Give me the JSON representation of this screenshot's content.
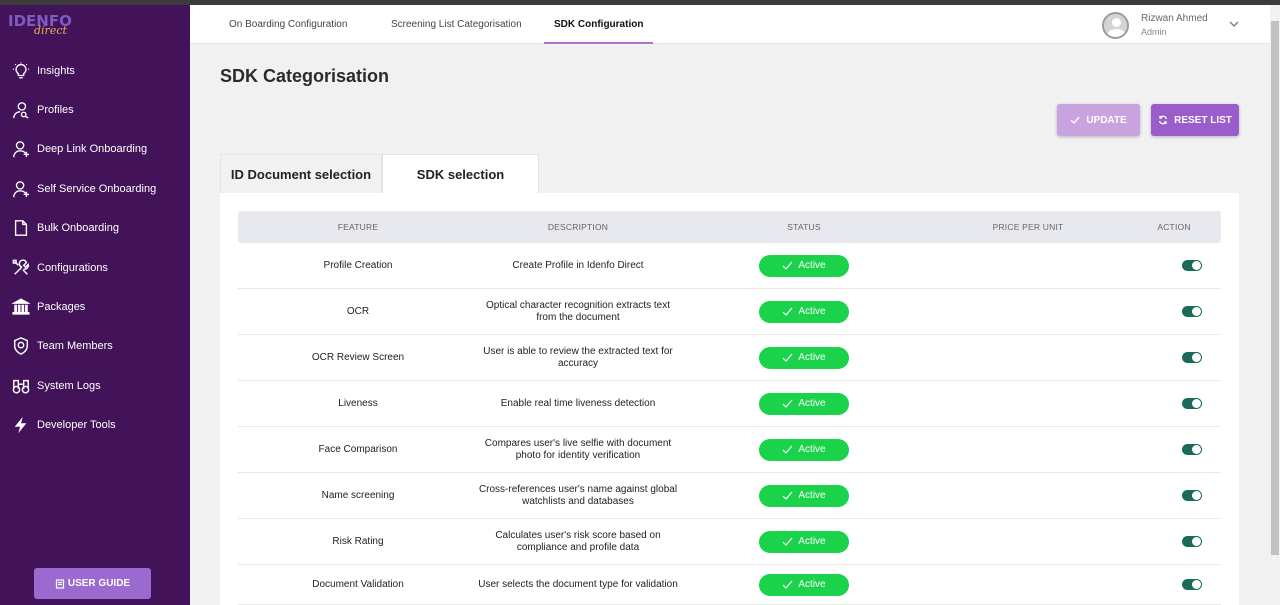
{
  "app": {
    "logo_main": "IDENFO",
    "logo_sub": "direct"
  },
  "sidebar": {
    "items": [
      {
        "label": "Insights",
        "icon": "lightbulb-icon"
      },
      {
        "label": "Profiles",
        "icon": "profiles-icon"
      },
      {
        "label": "Deep Link Onboarding",
        "icon": "user-add-icon"
      },
      {
        "label": "Self Service Onboarding",
        "icon": "user-add-icon"
      },
      {
        "label": "Bulk Onboarding",
        "icon": "document-icon"
      },
      {
        "label": "Configurations",
        "icon": "tools-icon"
      },
      {
        "label": "Packages",
        "icon": "bank-icon"
      },
      {
        "label": "Team Members",
        "icon": "shield-icon"
      },
      {
        "label": "System Logs",
        "icon": "binoculars-icon"
      },
      {
        "label": "Developer Tools",
        "icon": "lightning-icon"
      }
    ],
    "guide_label": "USER GUIDE"
  },
  "topnav": {
    "tabs": [
      {
        "label": "On Boarding Configuration"
      },
      {
        "label": "Screening List Categorisation"
      },
      {
        "label": "SDK Configuration"
      }
    ],
    "active_tab": "SDK Configuration",
    "user": {
      "name": "Rizwan Ahmed",
      "role": "Admin"
    }
  },
  "page": {
    "title": "SDK Categorisation",
    "update_label": "UPDATE",
    "reset_label": "RESET LIST",
    "subtabs": [
      {
        "label": "ID Document selection"
      },
      {
        "label": "SDK selection"
      }
    ],
    "active_subtab": "SDK selection"
  },
  "table": {
    "headers": {
      "feature": "FEATURE",
      "description": "DESCRIPTION",
      "status": "STATUS",
      "price": "PRICE PER UNIT",
      "action": "ACTION"
    },
    "rows": [
      {
        "feature": "Profile Creation",
        "desc1": "Create Profile in Idenfo Direct",
        "desc2": "",
        "status": "Active",
        "price": "",
        "enabled": true
      },
      {
        "feature": "OCR",
        "desc1": "Optical character recognition extracts text",
        "desc2": "from the document",
        "status": "Active",
        "price": "",
        "enabled": true
      },
      {
        "feature": "OCR Review Screen",
        "desc1": "User is able to review the extracted text for",
        "desc2": "accuracy",
        "status": "Active",
        "price": "",
        "enabled": true
      },
      {
        "feature": "Liveness",
        "desc1": "Enable real time liveness detection",
        "desc2": "",
        "status": "Active",
        "price": "",
        "enabled": true
      },
      {
        "feature": "Face Comparison",
        "desc1": "Compares user's live selfie with document",
        "desc2": "photo for identity verification",
        "status": "Active",
        "price": "",
        "enabled": true
      },
      {
        "feature": "Name screening",
        "desc1": "Cross-references user's name against global",
        "desc2": "watchlists and databases",
        "status": "Active",
        "price": "",
        "enabled": true
      },
      {
        "feature": "Risk Rating",
        "desc1": "Calculates user's risk score based on",
        "desc2": "compliance and profile data",
        "status": "Active",
        "price": "",
        "enabled": true
      },
      {
        "feature": "Document Validation",
        "desc1": "User selects the document type for validation",
        "desc2": "",
        "status": "Active",
        "price": "",
        "enabled": true
      }
    ]
  },
  "colors": {
    "sidebar": "#43135a",
    "accent": "#b16fd0",
    "active_badge": "#1ad34a",
    "toggle_on": "#1b6b5a"
  }
}
